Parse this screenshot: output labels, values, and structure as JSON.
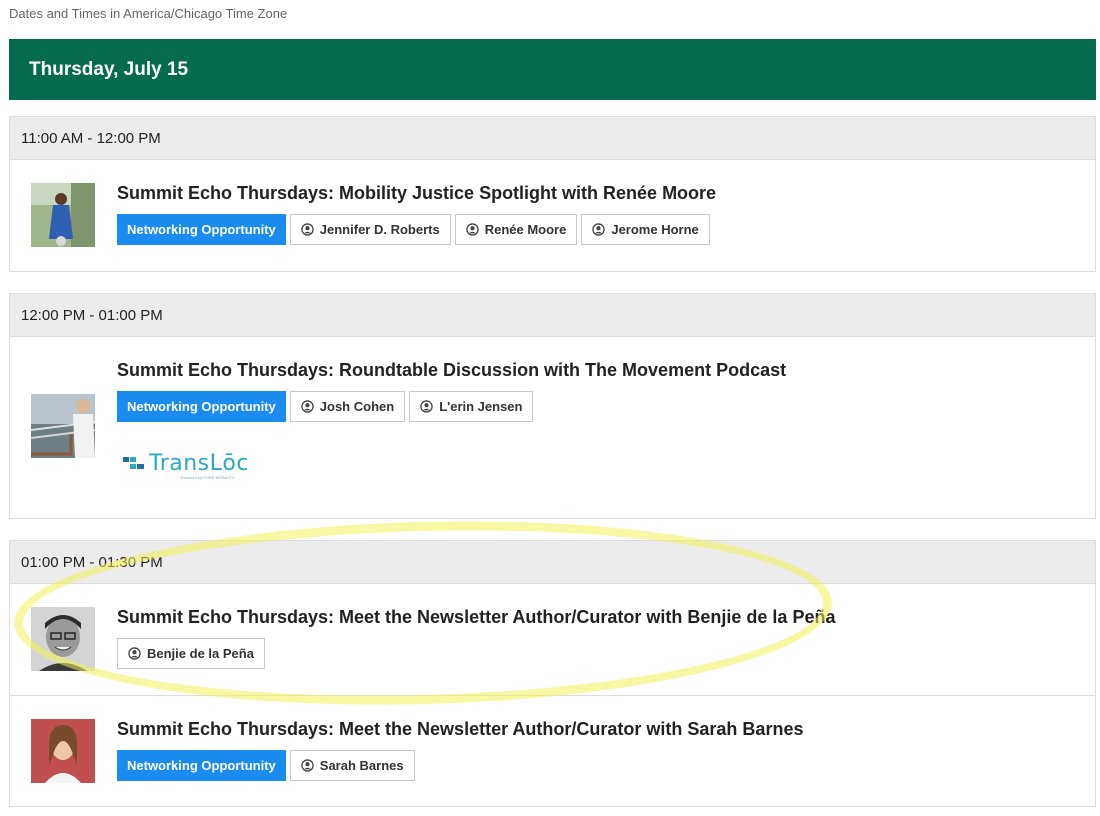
{
  "timezone_note": "Dates and Times in America/Chicago Time Zone",
  "day_header": "Thursday, July 15",
  "slots": [
    {
      "time": "11:00 AM - 12:00 PM",
      "sessions": [
        {
          "title": "Summit Echo Thursdays: Mobility Justice Spotlight with Renée Moore",
          "tag": "Networking Opportunity",
          "speakers": [
            "Jennifer D. Roberts",
            "Renée Moore",
            "Jerome Horne"
          ]
        }
      ]
    },
    {
      "time": "12:00 PM - 01:00 PM",
      "sessions": [
        {
          "title": "Summit Echo Thursdays: Roundtable Discussion with The Movement Podcast",
          "tag": "Networking Opportunity",
          "speakers": [
            "Josh Cohen",
            "L'erin Jensen"
          ],
          "sponsor": {
            "name": "TransLōc",
            "subtitle": "Powered by FORD MOBILITY"
          }
        }
      ]
    },
    {
      "time": "01:00 PM - 01:30 PM",
      "sessions": [
        {
          "title": "Summit Echo Thursdays: Meet the Newsletter Author/Curator with Benjie de la Peña",
          "speakers": [
            "Benjie de la Peña"
          ]
        },
        {
          "title": "Summit Echo Thursdays: Meet the Newsletter Author/Curator with Sarah Barnes",
          "tag": "Networking Opportunity",
          "speakers": [
            "Sarah Barnes"
          ]
        }
      ]
    }
  ],
  "colors": {
    "header_green": "#066b4e",
    "tag_blue": "#1a8cf0",
    "highlight_yellow": "#f0f05a"
  },
  "icons": {
    "speaker": "person-circle-icon"
  }
}
